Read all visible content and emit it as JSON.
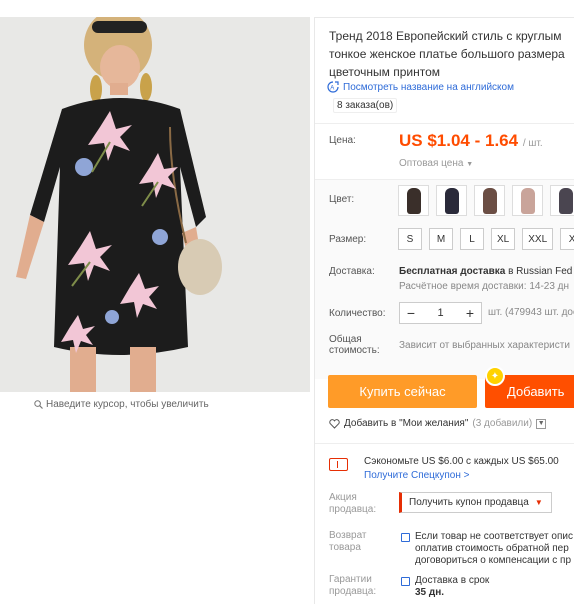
{
  "product": {
    "title_lines": [
      "Тренд 2018 Европейский стиль с круглым",
      "тонкое женское платье большого размера",
      "цветочным принтом"
    ],
    "translate_link": "Посмотреть название на английском",
    "orders": "8 заказа(ов)"
  },
  "gallery": {
    "zoom_hint": "Наведите курсор, чтобы увеличить"
  },
  "price": {
    "label": "Цена:",
    "value": "US $1.04 - 1.64",
    "unit": "/ шт.",
    "wholesale": "Оптовая цена"
  },
  "options": {
    "color_label": "Цвет:",
    "swatch_colors": [
      "#3a2f2a",
      "#2a2a3a",
      "#6b4e44",
      "#c9a49a",
      "#4a4550"
    ],
    "size_label": "Размер:",
    "sizes": [
      "S",
      "M",
      "L",
      "XL",
      "XXL",
      "X"
    ],
    "shipping_label": "Доставка:",
    "shipping_main_bold": "Бесплатная доставка",
    "shipping_main_rest": "в Russian Fed",
    "shipping_sub": "Расчётное время доставки: 14-23 дн",
    "quantity_label": "Количество:",
    "quantity_value": "1",
    "quantity_minus": "−",
    "quantity_plus": "+",
    "stock": "шт. (479943 шт. дос",
    "total_label_1": "Общая",
    "total_label_2": "стоимость:",
    "total_note": "Зависит от выбранных характеристи"
  },
  "actions": {
    "buy_now": "Купить сейчас",
    "add_to_cart": "Добавить",
    "wishlist": "Добавить в \"Мои желания\"",
    "wishlist_count": "(3 добавили)"
  },
  "coupon": {
    "save_text": "Сэкономьте US $6.00 с каждых US $65.00",
    "get_link": "Получите Спецкупон >",
    "seller_label_1": "Акция",
    "seller_label_2": "продавца:",
    "seller_button": "Получить купон продавца",
    "return_label_1": "Возврат",
    "return_label_2": "товара",
    "return_lines": [
      "Если товар не соответствует опис",
      "оплатив стоимость обратной пер",
      "договориться о компенсации с пр"
    ],
    "guarantee_label_1": "Гарантии",
    "guarantee_label_2": "продавца:",
    "guarantee_line": "Доставка в срок",
    "guarantee_days": "35 дн."
  },
  "colors": {
    "accent_orange": "#ff4c00",
    "buy_button": "#ff9b28",
    "cart_button": "#ff4f00",
    "link_blue": "#2e6bd8"
  }
}
